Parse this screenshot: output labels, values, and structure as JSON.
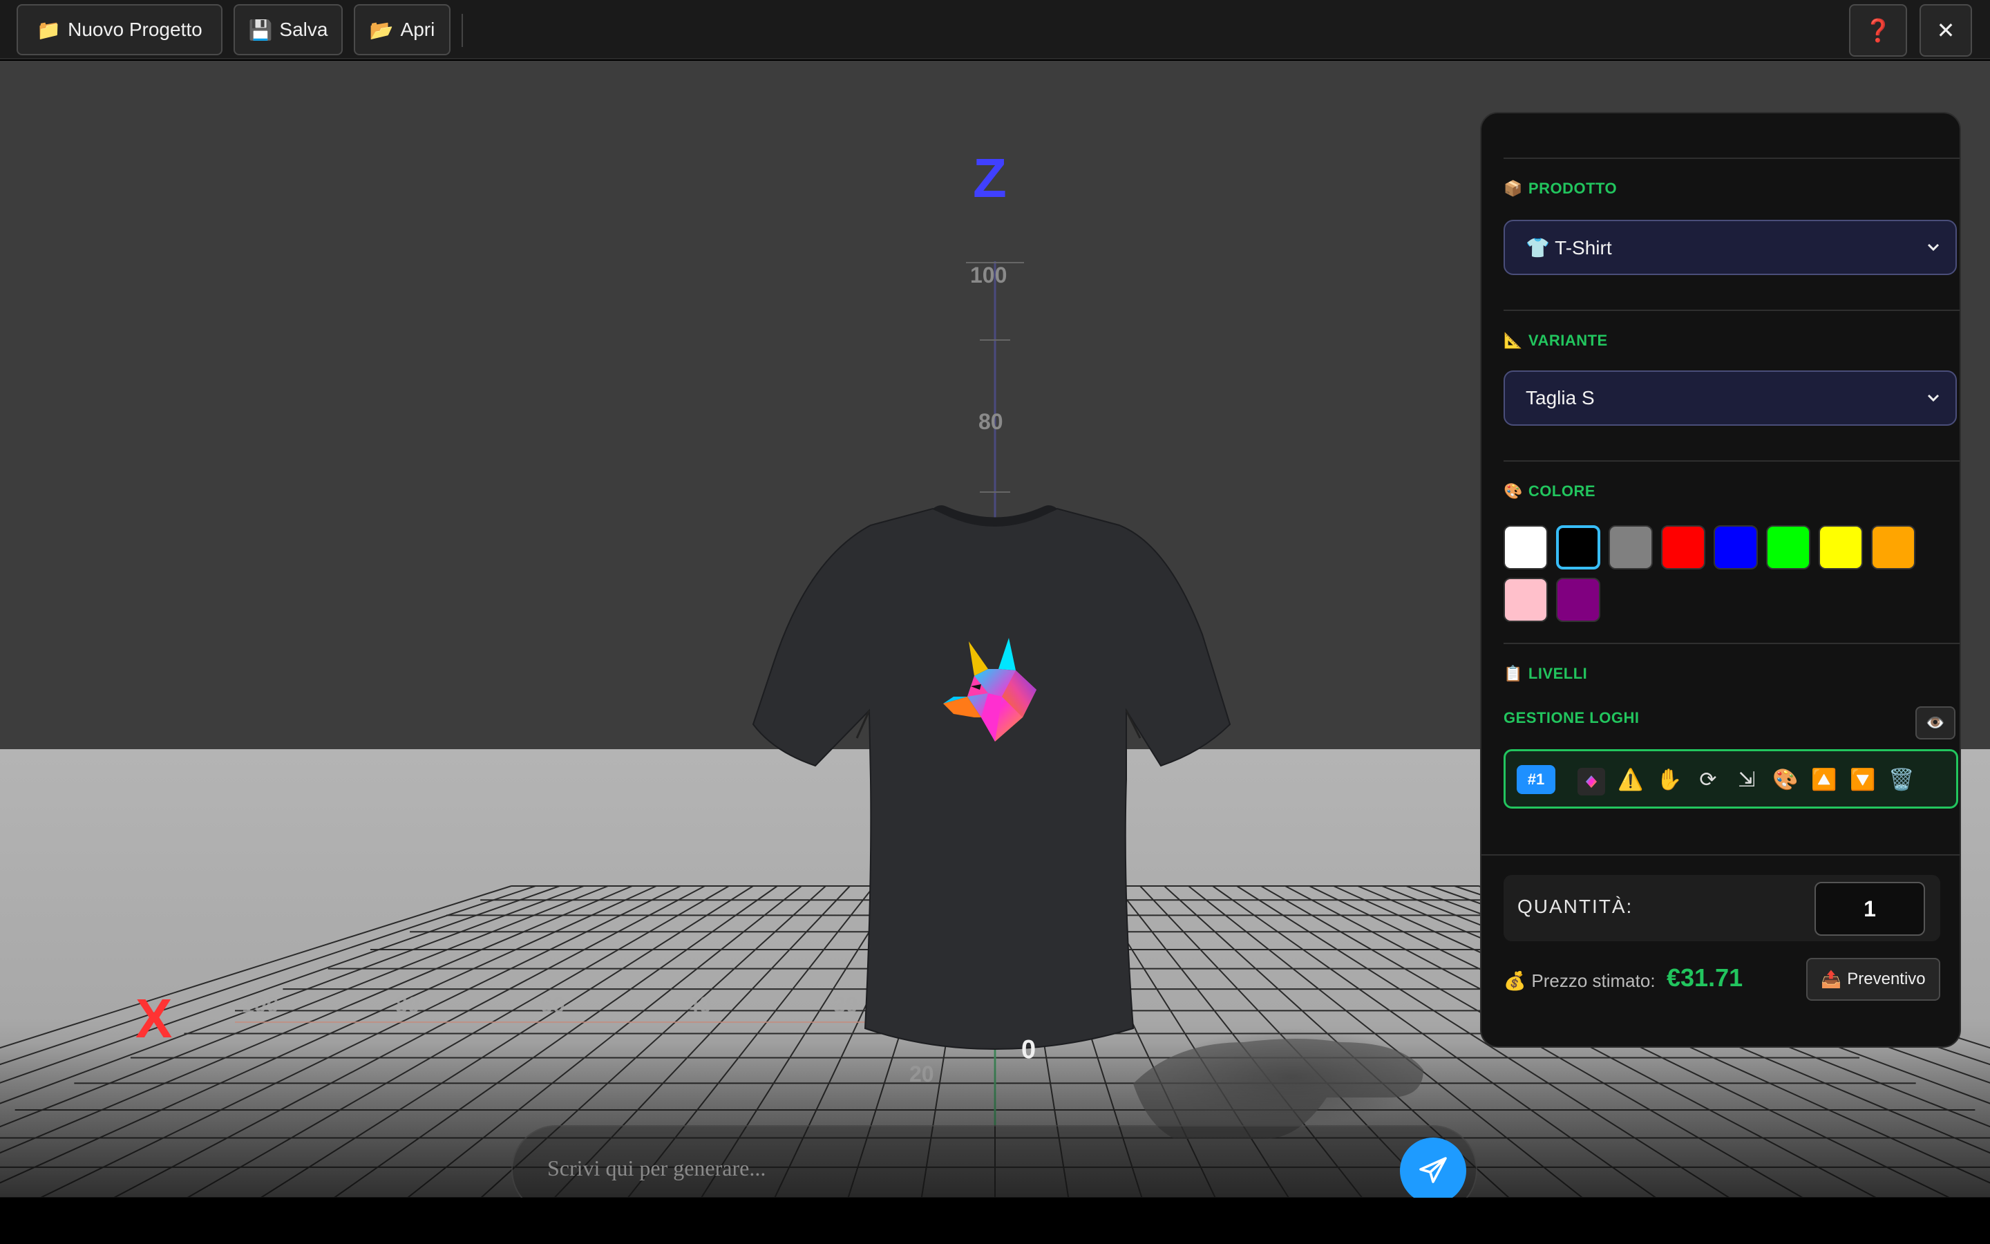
{
  "toolbar": {
    "new_project": "Nuovo Progetto",
    "save": "Salva",
    "open": "Apri",
    "icons": {
      "new_project": "📁",
      "save": "💾",
      "open": "📂"
    }
  },
  "corner": {
    "help": "❓",
    "close": "✕"
  },
  "scene": {
    "axis_z": "Z",
    "axis_x": "X",
    "z_ticks": [
      "100",
      "80"
    ],
    "x_ticks": [
      "100",
      "80",
      "60",
      "40",
      "30",
      "20"
    ],
    "origin": "0"
  },
  "panel": {
    "product": {
      "title": "PRODOTTO",
      "icon": "📦",
      "selected": "👕 T-Shirt"
    },
    "variant": {
      "title": "VARIANTE",
      "icon": "📐",
      "selected": "Taglia S"
    },
    "color": {
      "title": "COLORE",
      "icon": "🎨",
      "swatches": [
        "#ffffff",
        "#000000",
        "#808080",
        "#ff0000",
        "#0000ff",
        "#00ff00",
        "#ffff00",
        "#ffa500",
        "#ffc0cb",
        "#800080"
      ],
      "selected_index": 1
    },
    "layers": {
      "title": "LIVELLI",
      "icon": "📋",
      "subtitle": "GESTIONE LOGHI",
      "eye": "👁️",
      "logo_badge": "#1",
      "tools": [
        "⚠️",
        "✋",
        "⟳",
        "⇲",
        "🎨",
        "🔼",
        "🔽",
        "🗑️"
      ]
    },
    "quantity": {
      "label": "QUANTITÀ:",
      "value": "1"
    },
    "price": {
      "icon": "💰",
      "label": "Prezzo stimato:",
      "value": "€31.71"
    },
    "quote": {
      "icon": "📤",
      "label": "Preventivo"
    }
  },
  "prompt": {
    "placeholder": "Scrivi qui per generare..."
  },
  "colors": {
    "accent_green": "#22c55e",
    "accent_blue": "#1e9bff",
    "axis_z": "#4040ff",
    "axis_x": "#ff3333"
  }
}
